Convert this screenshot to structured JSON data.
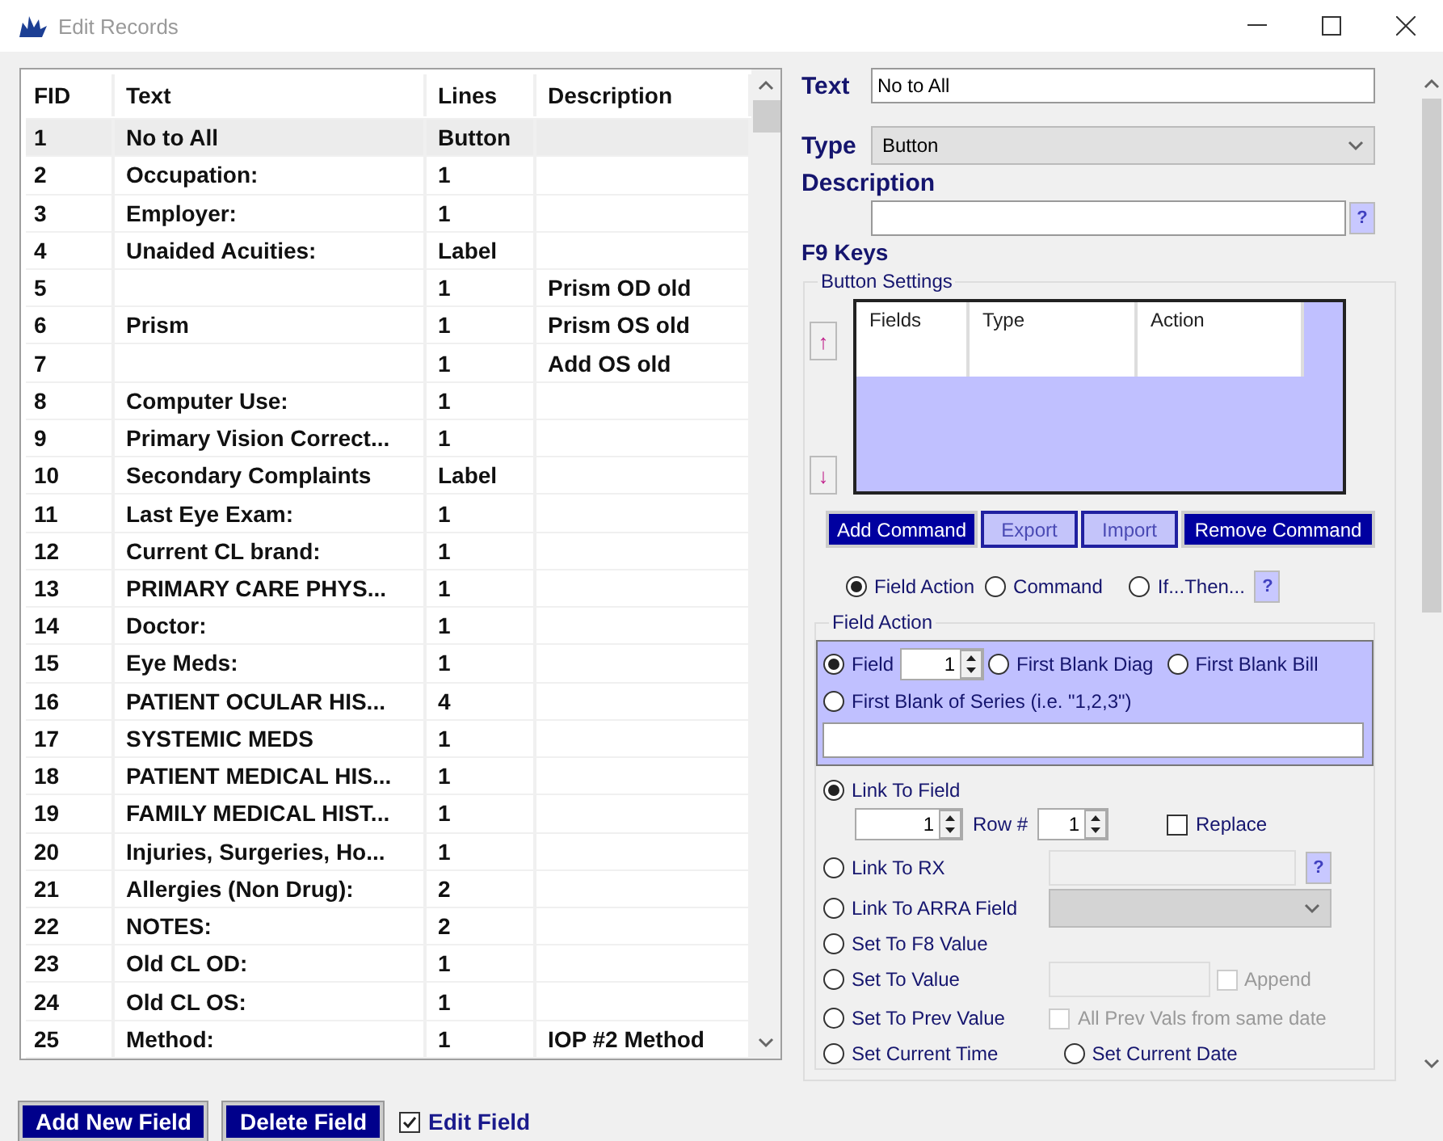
{
  "window": {
    "title": "Edit Records"
  },
  "table": {
    "columns": [
      "FID",
      "Text",
      "Lines",
      "Description"
    ],
    "rows": [
      {
        "cells": [
          "1",
          "No to All",
          "Button",
          ""
        ],
        "selected": true
      },
      {
        "cells": [
          "2",
          "Occupation:",
          "1",
          ""
        ],
        "selected": false
      },
      {
        "cells": [
          "3",
          "Employer:",
          "1",
          ""
        ],
        "selected": false
      },
      {
        "cells": [
          "4",
          "Unaided Acuities:",
          "Label",
          ""
        ],
        "selected": false
      },
      {
        "cells": [
          "5",
          "",
          "1",
          "Prism OD old"
        ],
        "selected": false
      },
      {
        "cells": [
          "6",
          "Prism",
          "1",
          "Prism OS old"
        ],
        "selected": false
      },
      {
        "cells": [
          "7",
          "",
          "1",
          "Add OS old"
        ],
        "selected": false
      },
      {
        "cells": [
          "8",
          "Computer Use:",
          "1",
          ""
        ],
        "selected": false
      },
      {
        "cells": [
          "9",
          "Primary Vision Correct...",
          "1",
          ""
        ],
        "selected": false
      },
      {
        "cells": [
          "10",
          "Secondary Complaints",
          "Label",
          ""
        ],
        "selected": false
      },
      {
        "cells": [
          "11",
          "Last Eye Exam:",
          "1",
          ""
        ],
        "selected": false
      },
      {
        "cells": [
          "12",
          "Current CL brand:",
          "1",
          ""
        ],
        "selected": false
      },
      {
        "cells": [
          "13",
          "PRIMARY CARE PHYS...",
          "1",
          ""
        ],
        "selected": false
      },
      {
        "cells": [
          "14",
          "Doctor:",
          "1",
          ""
        ],
        "selected": false
      },
      {
        "cells": [
          "15",
          "Eye Meds:",
          "1",
          ""
        ],
        "selected": false
      },
      {
        "cells": [
          "16",
          "PATIENT OCULAR HIS...",
          "4",
          ""
        ],
        "selected": false
      },
      {
        "cells": [
          "17",
          "SYSTEMIC MEDS",
          "1",
          ""
        ],
        "selected": false
      },
      {
        "cells": [
          "18",
          "PATIENT MEDICAL HIS...",
          "1",
          ""
        ],
        "selected": false
      },
      {
        "cells": [
          "19",
          "FAMILY MEDICAL HIST...",
          "1",
          ""
        ],
        "selected": false
      },
      {
        "cells": [
          "20",
          "Injuries, Surgeries, Ho...",
          "1",
          ""
        ],
        "selected": false
      },
      {
        "cells": [
          "21",
          "Allergies (Non Drug):",
          "2",
          ""
        ],
        "selected": false
      },
      {
        "cells": [
          "22",
          "NOTES:",
          "2",
          ""
        ],
        "selected": false
      },
      {
        "cells": [
          "23",
          "Old CL OD:",
          "1",
          ""
        ],
        "selected": false
      },
      {
        "cells": [
          "24",
          "Old CL OS:",
          "1",
          ""
        ],
        "selected": false
      },
      {
        "cells": [
          "25",
          "Method:",
          "1",
          "IOP #2 Method"
        ],
        "selected": false
      }
    ]
  },
  "bottom": {
    "buttons": [
      "Add New Field",
      "Delete Field"
    ],
    "edit_field": {
      "label": "Edit Field",
      "checked": true
    }
  },
  "editor": {
    "text": {
      "label": "Text",
      "value": "No to All"
    },
    "type": {
      "label": "Type",
      "value": "Button"
    },
    "description": {
      "label": "Description",
      "help": "?"
    },
    "f9_label": "F9 Keys",
    "button_settings": {
      "legend": "Button Settings",
      "up": "↑",
      "down": "↓",
      "columns": [
        "Fields",
        "Type",
        "Action"
      ],
      "buttons": [
        {
          "label": "Add Command",
          "disabled": false
        },
        {
          "label": "Export",
          "disabled": true
        },
        {
          "label": "Import",
          "disabled": true
        },
        {
          "label": "Remove Command",
          "disabled": false
        }
      ]
    },
    "mode": {
      "options": [
        {
          "label": "Field Action",
          "selected": true
        },
        {
          "label": "Command",
          "selected": false
        },
        {
          "label": "If...Then...",
          "selected": false
        }
      ],
      "help": "?"
    },
    "field_action": {
      "legend": "Field Action",
      "targets": [
        {
          "label": "Field",
          "selected": true,
          "value": "1"
        },
        {
          "label": "First Blank Diag",
          "selected": false
        },
        {
          "label": "First Blank Bill",
          "selected": false
        },
        {
          "label": "First Blank of Series (i.e. \"1,2,3\")",
          "selected": false
        }
      ]
    },
    "actions": [
      {
        "kind": "link_field",
        "label": "Link To Field",
        "selected": true,
        "value": "1",
        "row_label": "Row #",
        "row_value": "1",
        "replace": {
          "label": "Replace",
          "checked": false
        }
      },
      {
        "kind": "rx",
        "label": "Link To RX",
        "selected": false,
        "help": "?"
      },
      {
        "kind": "arra",
        "label": "Link To ARRA Field",
        "selected": false
      },
      {
        "kind": "plain",
        "label": "Set To F8 Value",
        "selected": false
      },
      {
        "kind": "value",
        "label": "Set To Value",
        "selected": false,
        "append": {
          "label": "Append",
          "checked": false
        }
      },
      {
        "kind": "prev",
        "label": "Set To Prev Value",
        "selected": false,
        "all_prev": {
          "label": "All Prev Vals from same date",
          "checked": false
        }
      },
      {
        "kind": "pair",
        "options": [
          {
            "label": "Set Current Time",
            "selected": false
          },
          {
            "label": "Set Current Date",
            "selected": false
          }
        ]
      }
    ]
  }
}
